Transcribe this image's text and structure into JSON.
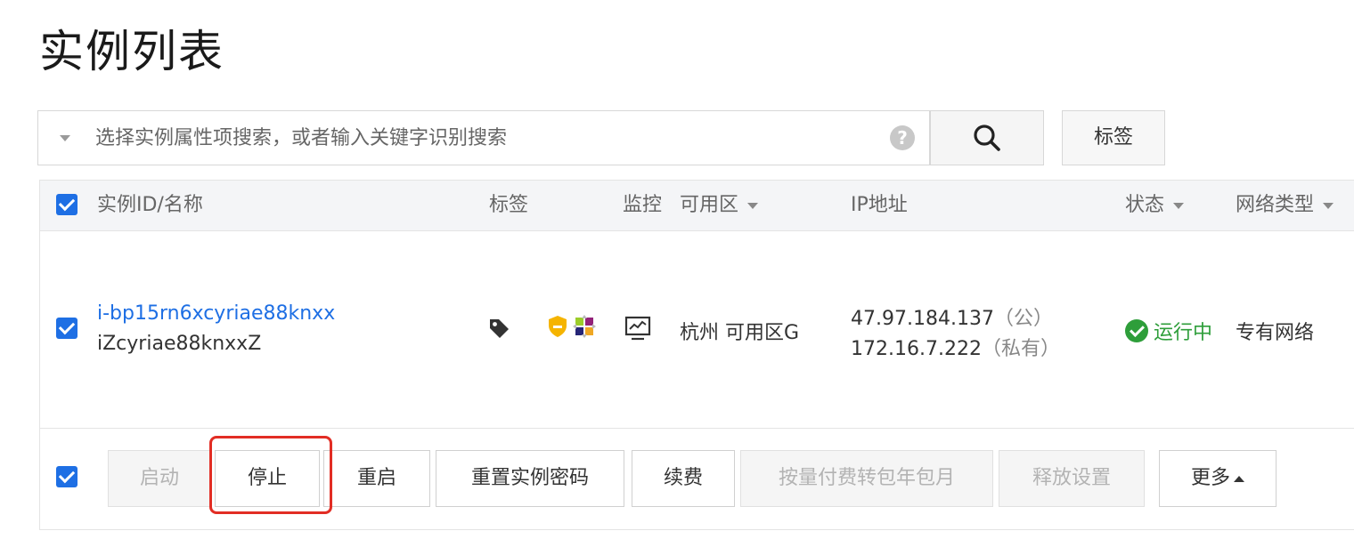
{
  "page": {
    "title": "实例列表"
  },
  "search": {
    "placeholder": "选择实例属性项搜索，或者输入关键字识别搜索",
    "help_symbol": "?"
  },
  "tag_filter_label": "标签",
  "table": {
    "columns": {
      "id_name": "实例ID/名称",
      "tags": "标签",
      "monitor": "监控",
      "zone": "可用区",
      "ip": "IP地址",
      "status": "状态",
      "network": "网络类型"
    },
    "rows": [
      {
        "instance_id": "i-bp15rn6xcyriae88knxx",
        "instance_name": "iZcyriae88knxxZ",
        "zone": "杭州 可用区G",
        "public_ip": "47.97.184.137",
        "public_ip_type": "（公）",
        "private_ip": "172.16.7.222",
        "private_ip_type": "（私有）",
        "status": "运行中",
        "network_type": "专有网络",
        "selected": true
      }
    ]
  },
  "actions": {
    "start": "启动",
    "stop": "停止",
    "restart": "重启",
    "reset_password": "重置实例密码",
    "renew": "续费",
    "convert_billing": "按量付费转包年包月",
    "release_settings": "释放设置",
    "more": "更多"
  },
  "colors": {
    "accent": "#1e6fe4",
    "status_running": "#2e9e3a",
    "highlight": "#e22d24"
  }
}
